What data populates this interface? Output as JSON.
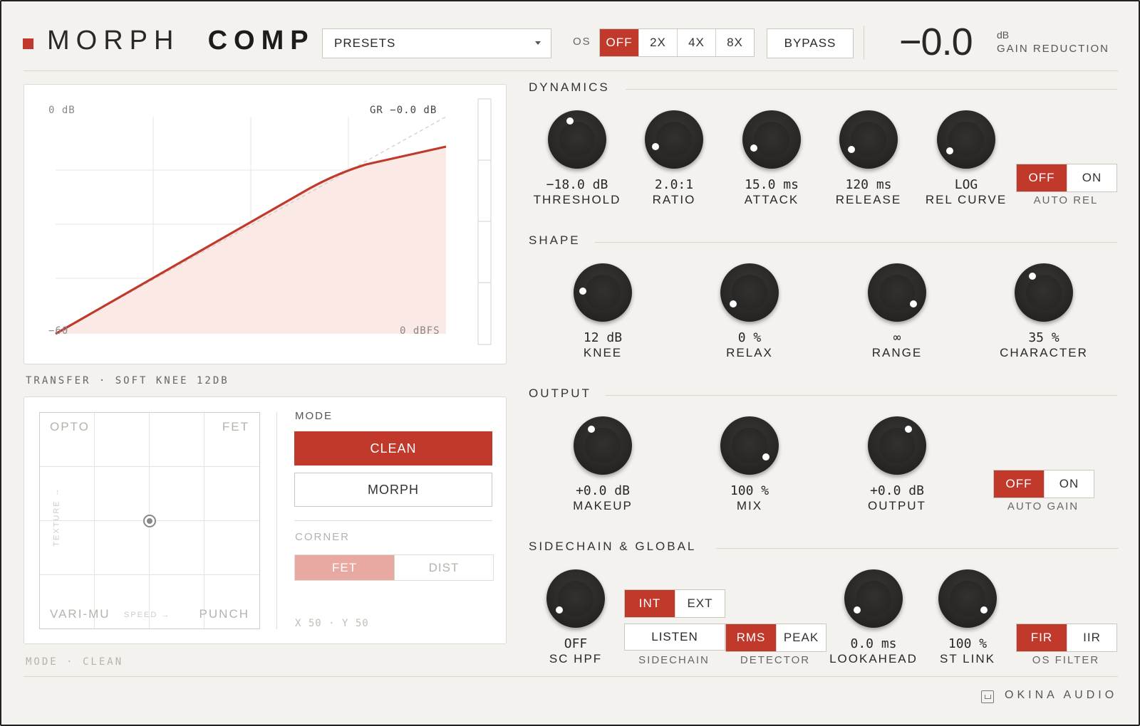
{
  "header": {
    "title_light": "MORPH",
    "title_bold": "COMP",
    "presets_label": "PRESETS",
    "os_label": "OS",
    "os_options": [
      "OFF",
      "2X",
      "4X",
      "8X"
    ],
    "os_selected": "OFF",
    "bypass_label": "BYPASS",
    "gain_reduction_value": "−0.0",
    "gain_reduction_unit": "dB",
    "gain_reduction_label": "GAIN REDUCTION"
  },
  "graph": {
    "top_left_label": "0 dB",
    "readout": "GR −0.0 dB",
    "bottom_left_label": "−60",
    "bottom_right_label": "0 dBFS",
    "caption": "TRANSFER · SOFT KNEE 12DB"
  },
  "xy_pad": {
    "corners": {
      "tl": "OPTO",
      "tr": "FET",
      "bl": "VARI-MU",
      "br": "PUNCH"
    },
    "axis_x": "SPEED →",
    "axis_y": "TEXTURE →",
    "x": 50,
    "y": 50,
    "readout": "X 50 · Y 50",
    "mode_label": "MODE",
    "mode_options": [
      "CLEAN",
      "MORPH"
    ],
    "mode_selected": "CLEAN",
    "corner_label": "CORNER",
    "corner_options": [
      "FET",
      "DIST"
    ],
    "corner_selected": "FET",
    "status": "MODE · CLEAN"
  },
  "dynamics": {
    "title": "DYNAMICS",
    "knobs": [
      {
        "value": "−18.0 dB",
        "label": "THRESHOLD"
      },
      {
        "value": "2.0:1",
        "label": "RATIO"
      },
      {
        "value": "15.0 ms",
        "label": "ATTACK"
      },
      {
        "value": "120 ms",
        "label": "RELEASE"
      },
      {
        "value": "LOG",
        "label": "REL CURVE"
      }
    ],
    "auto_rel": {
      "options": [
        "OFF",
        "ON"
      ],
      "selected": "OFF",
      "label": "AUTO REL"
    }
  },
  "shape": {
    "title": "SHAPE",
    "knobs": [
      {
        "value": "12 dB",
        "label": "KNEE"
      },
      {
        "value": "0 %",
        "label": "RELAX"
      },
      {
        "value": "∞",
        "label": "RANGE"
      },
      {
        "value": "35 %",
        "label": "CHARACTER"
      }
    ]
  },
  "output": {
    "title": "OUTPUT",
    "knobs": [
      {
        "value": "+0.0 dB",
        "label": "MAKEUP"
      },
      {
        "value": "100 %",
        "label": "MIX"
      },
      {
        "value": "+0.0 dB",
        "label": "OUTPUT"
      }
    ],
    "auto_gain": {
      "options": [
        "OFF",
        "ON"
      ],
      "selected": "OFF",
      "label": "AUTO GAIN"
    }
  },
  "sidechain": {
    "title": "SIDECHAIN & GLOBAL",
    "sc_hpf": {
      "value": "OFF",
      "label": "SC HPF"
    },
    "source": {
      "options": [
        "INT",
        "EXT"
      ],
      "selected": "INT"
    },
    "listen_label": "LISTEN",
    "sidechain_label": "SIDECHAIN",
    "detector": {
      "options": [
        "RMS",
        "PEAK"
      ],
      "selected": "RMS",
      "label": "DETECTOR"
    },
    "lookahead": {
      "value": "0.0 ms",
      "label": "LOOKAHEAD"
    },
    "st_link": {
      "value": "100 %",
      "label": "ST LINK"
    },
    "os_filter": {
      "options": [
        "FIR",
        "IIR"
      ],
      "selected": "FIR",
      "label": "OS FILTER"
    }
  },
  "footer": {
    "brand": "OKINA AUDIO"
  },
  "colors": {
    "accent": "#c0392b",
    "knob": "#2b2928",
    "background": "#f4f2ee"
  }
}
